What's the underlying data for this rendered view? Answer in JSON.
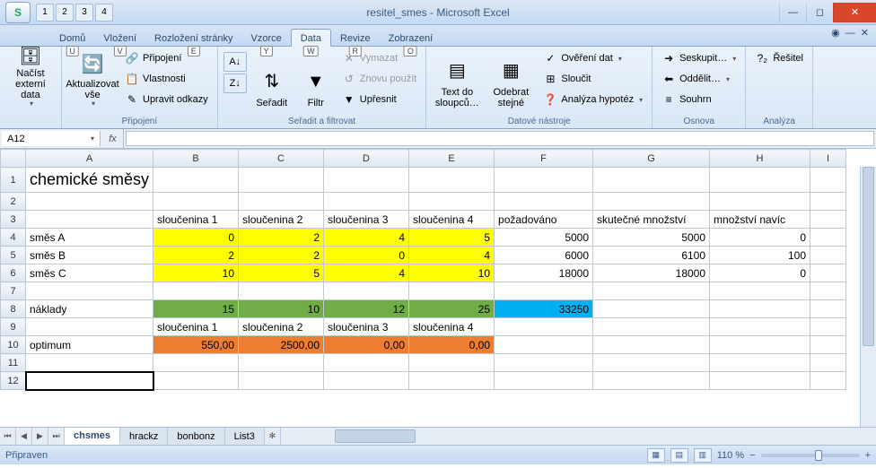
{
  "window": {
    "title": "resitel_smes - Microsoft Excel"
  },
  "qat_keys": [
    "1",
    "2",
    "3",
    "4"
  ],
  "tabs": {
    "items": [
      {
        "label": "Domů",
        "key": "U"
      },
      {
        "label": "Vložení",
        "key": "V"
      },
      {
        "label": "Rozložení stránky",
        "key": "E"
      },
      {
        "label": "Vzorce",
        "key": "Y"
      },
      {
        "label": "Data",
        "key": "W"
      },
      {
        "label": "Revize",
        "key": "R"
      },
      {
        "label": "Zobrazení",
        "key": "O"
      }
    ],
    "active_index": 4
  },
  "ribbon": {
    "g0": {
      "btn0": "Načíst externí data",
      "label": ""
    },
    "g1": {
      "btn0": "Aktualizovat vše",
      "s0": "Připojení",
      "s1": "Vlastnosti",
      "s2": "Upravit odkazy",
      "label": "Připojení"
    },
    "g2": {
      "btn0": "Seřadit",
      "btn1": "Filtr",
      "s0": "Vymazat",
      "s1": "Znovu použít",
      "s2": "Upřesnit",
      "label": "Seřadit a filtrovat"
    },
    "g3": {
      "btn0": "Text do sloupců…",
      "btn1": "Odebrat stejné",
      "s0": "Ověření dat",
      "s1": "Sloučit",
      "s2": "Analýza hypotéz",
      "label": "Datové nástroje"
    },
    "g4": {
      "s0": "Seskupit…",
      "s1": "Oddělit…",
      "s2": "Souhrn",
      "label": "Osnova"
    },
    "g5": {
      "s0": "Řešitel",
      "label": "Analýza"
    }
  },
  "name_box": "A12",
  "sheet": {
    "columns": [
      "A",
      "B",
      "C",
      "D",
      "E",
      "F",
      "G",
      "H",
      "I"
    ],
    "rows": [
      "1",
      "2",
      "3",
      "4",
      "5",
      "6",
      "7",
      "8",
      "9",
      "10",
      "11",
      "12"
    ],
    "title": "chemické směsy",
    "r3": {
      "B": "sloučenina 1",
      "C": "sloučenina 2",
      "D": "sloučenina 3",
      "E": "sloučenina 4",
      "F": "požadováno",
      "G": "skutečné množství",
      "H": "množství navíc"
    },
    "r4": {
      "A": "směs A",
      "B": "0",
      "C": "2",
      "D": "4",
      "E": "5",
      "F": "5000",
      "G": "5000",
      "H": "0"
    },
    "r5": {
      "A": "směs B",
      "B": "2",
      "C": "2",
      "D": "0",
      "E": "4",
      "F": "6000",
      "G": "6100",
      "H": "100"
    },
    "r6": {
      "A": "směs C",
      "B": "10",
      "C": "5",
      "D": "4",
      "E": "10",
      "F": "18000",
      "G": "18000",
      "H": "0"
    },
    "r8": {
      "A": "náklady",
      "B": "15",
      "C": "10",
      "D": "12",
      "E": "25",
      "F": "33250"
    },
    "r9": {
      "B": "sloučenina 1",
      "C": "sloučenina 2",
      "D": "sloučenina 3",
      "E": "sloučenina 4"
    },
    "r10": {
      "A": "optimum",
      "B": "550,00",
      "C": "2500,00",
      "D": "0,00",
      "E": "0,00"
    }
  },
  "sheet_tabs": [
    "chsmes",
    "hrackz",
    "bonbonz",
    "List3"
  ],
  "active_sheet_tab": 0,
  "status": {
    "left": "Připraven",
    "zoom": "110 %"
  },
  "chart_data": {
    "type": "table",
    "title": "chemické směsy",
    "columns": [
      "",
      "sloučenina 1",
      "sloučenina 2",
      "sloučenina 3",
      "sloučenina 4",
      "požadováno",
      "skutečné množství",
      "množství navíc"
    ],
    "rows": [
      [
        "směs A",
        0,
        2,
        4,
        5,
        5000,
        5000,
        0
      ],
      [
        "směs B",
        2,
        2,
        0,
        4,
        6000,
        6100,
        100
      ],
      [
        "směs C",
        10,
        5,
        4,
        10,
        18000,
        18000,
        0
      ]
    ],
    "naklady": [
      15,
      10,
      12,
      25,
      33250
    ],
    "optimum": [
      550.0,
      2500.0,
      0.0,
      0.0
    ]
  }
}
